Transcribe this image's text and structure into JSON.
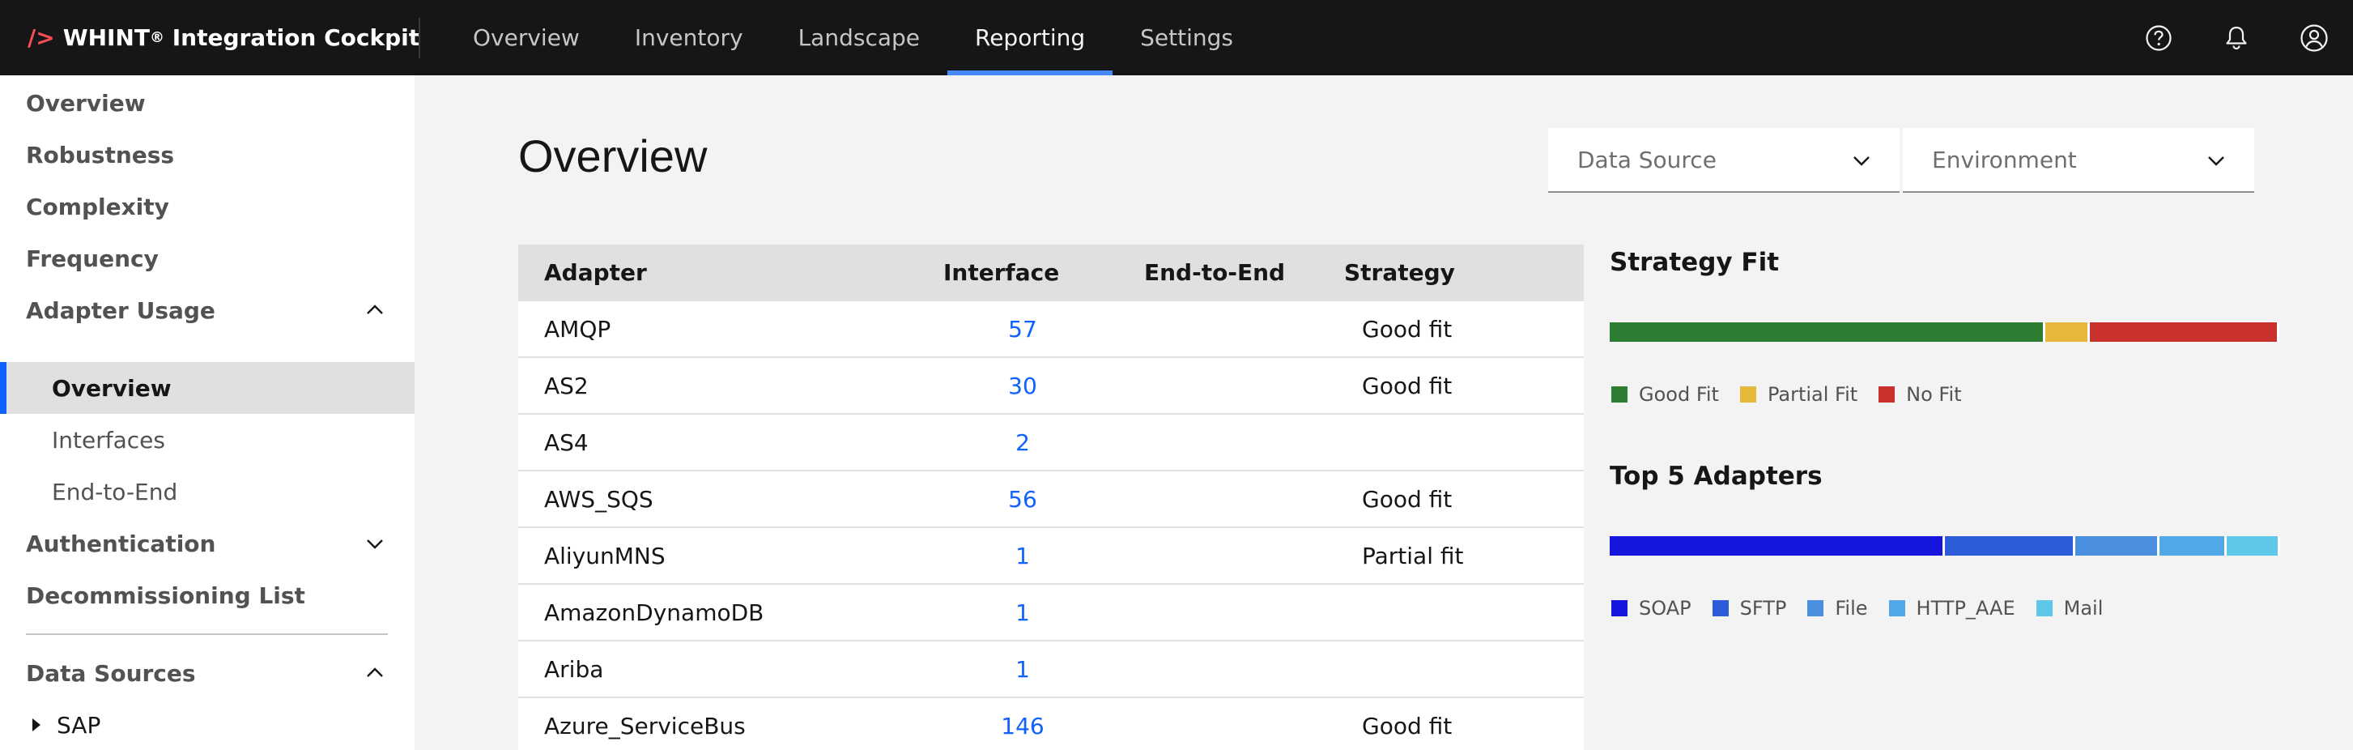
{
  "header": {
    "brand_slash": "/>",
    "brand_name": "WHINT",
    "brand_reg": "®",
    "brand_suffix": " Integration Cockpit",
    "nav": [
      {
        "label": "Overview",
        "active": false
      },
      {
        "label": "Inventory",
        "active": false
      },
      {
        "label": "Landscape",
        "active": false
      },
      {
        "label": "Reporting",
        "active": true
      },
      {
        "label": "Settings",
        "active": false
      }
    ],
    "icons": [
      "help-icon",
      "notification-bell-icon",
      "user-avatar-icon"
    ]
  },
  "sidebar": {
    "items": [
      {
        "label": "Overview"
      },
      {
        "label": "Robustness"
      },
      {
        "label": "Complexity"
      },
      {
        "label": "Frequency"
      },
      {
        "label": "Adapter Usage",
        "chevron": "up"
      },
      {
        "label": "Overview",
        "sub": true,
        "active": true
      },
      {
        "label": "Interfaces",
        "sub": true
      },
      {
        "label": "End-to-End",
        "sub": true
      },
      {
        "label": "Authentication",
        "chevron": "down"
      },
      {
        "label": "Decommissioning List"
      },
      {
        "label": "Data Sources",
        "chevron": "up"
      },
      {
        "label": "SAP",
        "tree": true
      }
    ]
  },
  "main": {
    "title": "Overview",
    "filters": {
      "data_source": "Data Source",
      "environment": "Environment"
    }
  },
  "table": {
    "headers": {
      "adapter": "Adapter",
      "interface": "Interface",
      "end_to_end": "End-to-End",
      "strategy": "Strategy"
    },
    "rows": [
      {
        "adapter": "AMQP",
        "interface": "57",
        "end_to_end": "",
        "strategy": "Good fit"
      },
      {
        "adapter": "AS2",
        "interface": "30",
        "end_to_end": "",
        "strategy": "Good fit"
      },
      {
        "adapter": "AS4",
        "interface": "2",
        "end_to_end": "",
        "strategy": ""
      },
      {
        "adapter": "AWS_SQS",
        "interface": "56",
        "end_to_end": "",
        "strategy": "Good fit"
      },
      {
        "adapter": "AliyunMNS",
        "interface": "1",
        "end_to_end": "",
        "strategy": "Partial fit"
      },
      {
        "adapter": "AmazonDynamoDB",
        "interface": "1",
        "end_to_end": "",
        "strategy": ""
      },
      {
        "adapter": "Ariba",
        "interface": "1",
        "end_to_end": "",
        "strategy": ""
      },
      {
        "adapter": "Azure_ServiceBus",
        "interface": "146",
        "end_to_end": "",
        "strategy": "Good fit"
      }
    ]
  },
  "strategy_fit": {
    "title": "Strategy Fit",
    "segments": [
      {
        "label": "Good Fit",
        "fraction": 0.65,
        "color": "#2e7d32"
      },
      {
        "label": "Partial Fit",
        "fraction": 0.067,
        "color": "#e6b93c"
      },
      {
        "label": "No Fit",
        "fraction": 0.283,
        "color": "#c8312c"
      }
    ]
  },
  "top_adapters": {
    "title": "Top 5 Adapters",
    "segments": [
      {
        "label": "SOAP",
        "fraction": 0.5,
        "color": "#1515de"
      },
      {
        "label": "SFTP",
        "fraction": 0.195,
        "color": "#2e5cd8"
      },
      {
        "label": "File",
        "fraction": 0.125,
        "color": "#4a8ee0"
      },
      {
        "label": "HTTP_AAE",
        "fraction": 0.1,
        "color": "#52a8e6"
      },
      {
        "label": "Mail",
        "fraction": 0.08,
        "color": "#5ec8ea"
      }
    ]
  }
}
